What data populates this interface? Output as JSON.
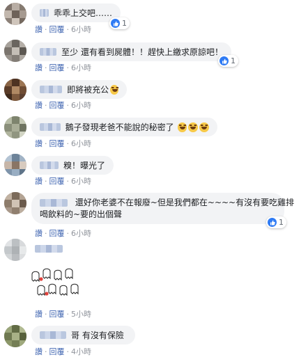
{
  "meta_labels": {
    "like": "讚",
    "reply": "回覆",
    "dot": "·"
  },
  "comments": [
    {
      "text": "乖乖上交吧……",
      "time": "6小時",
      "reactions": "1"
    },
    {
      "text": "至少 還有看到屍體！！趕快上繳求原諒吧！",
      "time": "6小時",
      "reactions": "1"
    },
    {
      "text": "即將被充公",
      "time": "6小時",
      "emoji_count": 1
    },
    {
      "text": "鵝子發現老爸不能說的秘密了",
      "time": "6小時",
      "emoji_count": 3
    },
    {
      "text": "糗！曝光了",
      "time": "6小時"
    },
    {
      "text_line1": "還好你老婆不在報廢~但是我們都在~~~~有沒有要吃雞排",
      "text_line2": "喝飲料的~要的出個聲",
      "time": "6小時",
      "reactions": "1"
    },
    {
      "time": "5小時",
      "sticker": "dancing-ghosts-sticker"
    },
    {
      "text": "哥 有沒有保險",
      "time": "4小時"
    }
  ],
  "colors": {
    "bubble_bg": "#f2f3f5",
    "link": "#4267b2",
    "muted": "#90949c",
    "like_blue": "#2f7bf4"
  }
}
